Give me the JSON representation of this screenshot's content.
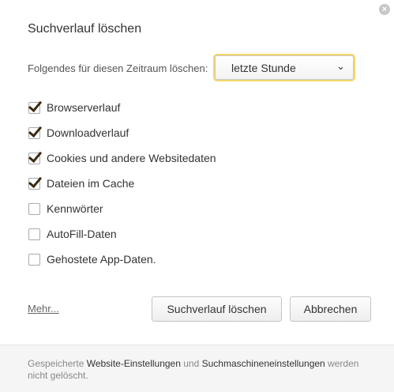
{
  "dialog": {
    "title": "Suchverlauf löschen",
    "close_glyph": "×"
  },
  "time_range": {
    "label": "Folgendes für diesen Zeitraum löschen:",
    "selected": "letzte Stunde",
    "chevron": "⌄"
  },
  "options": [
    {
      "label": "Browserverlauf",
      "checked": true
    },
    {
      "label": "Downloadverlauf",
      "checked": true
    },
    {
      "label": "Cookies und andere Websitedaten",
      "checked": true
    },
    {
      "label": "Dateien im Cache",
      "checked": true
    },
    {
      "label": "Kennwörter",
      "checked": false
    },
    {
      "label": "AutoFill-Daten",
      "checked": false
    },
    {
      "label": "Gehostete App-Daten.",
      "checked": false
    }
  ],
  "actions": {
    "more_link": "Mehr...",
    "clear_button": "Suchverlauf löschen",
    "cancel_button": "Abbrechen"
  },
  "footer": {
    "prefix": "Gespeicherte ",
    "link1": "Website-Einstellungen",
    "middle": " und ",
    "link2": "Suchmaschineneinstellungen",
    "suffix": " werden nicht gelöscht."
  },
  "colors": {
    "focus_ring": "#f2d96b",
    "checkmark": "#3b2a12",
    "footer_bg": "#f5f5f5"
  }
}
